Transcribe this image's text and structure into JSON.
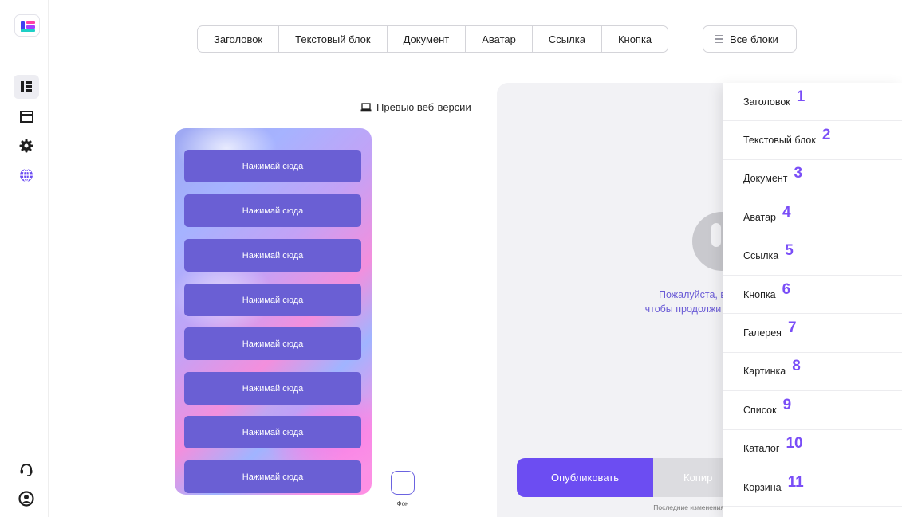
{
  "toolbar": {
    "tabs": [
      "Заголовок",
      "Текстовый блок",
      "Документ",
      "Аватар",
      "Ссылка",
      "Кнопка"
    ],
    "all_blocks_label": "Все блоки"
  },
  "preview": {
    "label": "Превью веб-версии"
  },
  "phone": {
    "buttons": [
      "Нажимай сюда",
      "Нажимай сюда",
      "Нажимай сюда",
      "Нажимай сюда",
      "Нажимай сюда",
      "Нажимай сюда",
      "Нажимай сюда",
      "Нажимай сюда"
    ],
    "background_label": "Фон"
  },
  "panel": {
    "notice_line1": "Пожалуйста, в",
    "notice_line2": "чтобы продолжит",
    "publish_label": "Опубликовать",
    "copy_label": "Копир",
    "last_changes": "Последние изменения"
  },
  "dropdown": {
    "items": [
      {
        "label": "Заголовок",
        "num": "1"
      },
      {
        "label": "Текстовый блок",
        "num": "2"
      },
      {
        "label": "Документ",
        "num": "3"
      },
      {
        "label": "Аватар",
        "num": "4"
      },
      {
        "label": "Ссылка",
        "num": "5"
      },
      {
        "label": "Кнопка",
        "num": "6"
      },
      {
        "label": "Галерея",
        "num": "7"
      },
      {
        "label": "Картинка",
        "num": "8"
      },
      {
        "label": "Список",
        "num": "9"
      },
      {
        "label": "Каталог",
        "num": "10"
      },
      {
        "label": "Корзина",
        "num": "11"
      }
    ]
  },
  "colors": {
    "accent": "#6c4df2",
    "phone_button": "#6a5fd4",
    "annotation": "#7a4ef7"
  }
}
